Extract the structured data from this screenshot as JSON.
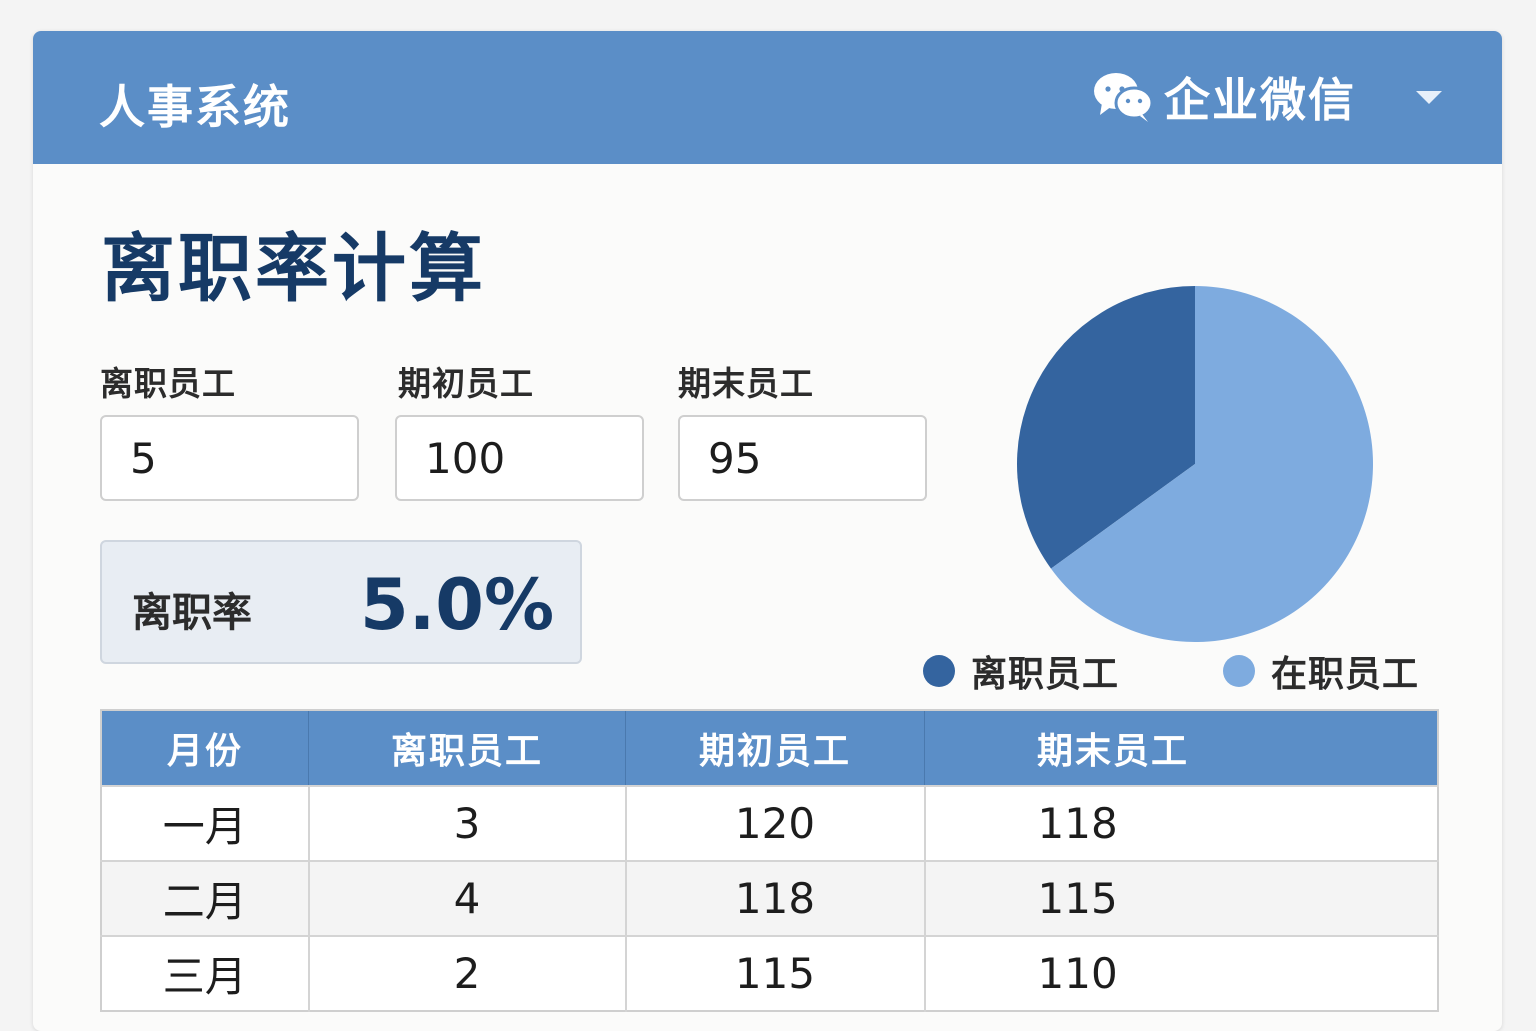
{
  "header": {
    "app_title": "人事系统",
    "wechat_label": "企业微信"
  },
  "page": {
    "title": "离职率计算"
  },
  "form": {
    "fields": [
      {
        "label": "离职员工",
        "value": "5"
      },
      {
        "label": "期初员工",
        "value": "100"
      },
      {
        "label": "期末员工",
        "value": "95"
      }
    ],
    "rate_label": "离职率",
    "rate_value": "5.0%"
  },
  "legend": {
    "items": [
      {
        "label": "离职员工",
        "color": "#34649f"
      },
      {
        "label": "在职员工",
        "color": "#7eabdf"
      }
    ]
  },
  "chart_data": {
    "type": "pie",
    "slices": [
      {
        "name": "离职员工",
        "value": 35,
        "color": "#34649f"
      },
      {
        "name": "在职员工",
        "value": 65,
        "color": "#7eabdf"
      }
    ]
  },
  "table": {
    "headers": [
      "月份",
      "离职员工",
      "期初员工",
      "期末员工"
    ],
    "rows": [
      [
        "一月",
        "3",
        "120",
        "118"
      ],
      [
        "二月",
        "4",
        "118",
        "115"
      ],
      [
        "三月",
        "2",
        "115",
        "110"
      ]
    ]
  },
  "colors": {
    "header_bg": "#5b8ec7",
    "title_text": "#163a66",
    "pie_dark": "#34649f",
    "pie_light": "#7eabdf"
  }
}
